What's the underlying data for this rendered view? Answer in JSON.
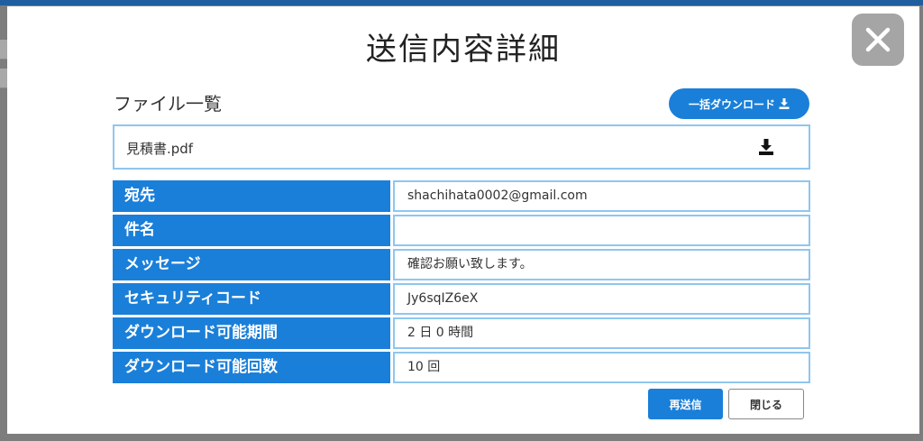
{
  "dialog": {
    "title": "送信内容詳細"
  },
  "files": {
    "heading": "ファイル一覧",
    "bulk_download_label": "一括ダウンロード",
    "items": [
      {
        "name": "見積書.pdf"
      }
    ]
  },
  "details": [
    {
      "label": "宛先",
      "value": "shachihata0002@gmail.com"
    },
    {
      "label": "件名",
      "value": ""
    },
    {
      "label": "メッセージ",
      "value": "確認お願い致します。"
    },
    {
      "label": "セキュリティコード",
      "value": "Jy6sqIZ6eX"
    },
    {
      "label": "ダウンロード可能期間",
      "value": "2 日 0 時間"
    },
    {
      "label": "ダウンロード可能回数",
      "value": "10 回"
    }
  ],
  "footer": {
    "resend_label": "再送信",
    "close_label": "閉じる"
  },
  "icons": {
    "close": "close-icon",
    "download": "download-icon"
  },
  "colors": {
    "accent": "#1a7fd9",
    "border": "#8fc6ef",
    "overlay": "#7d7d7d"
  }
}
